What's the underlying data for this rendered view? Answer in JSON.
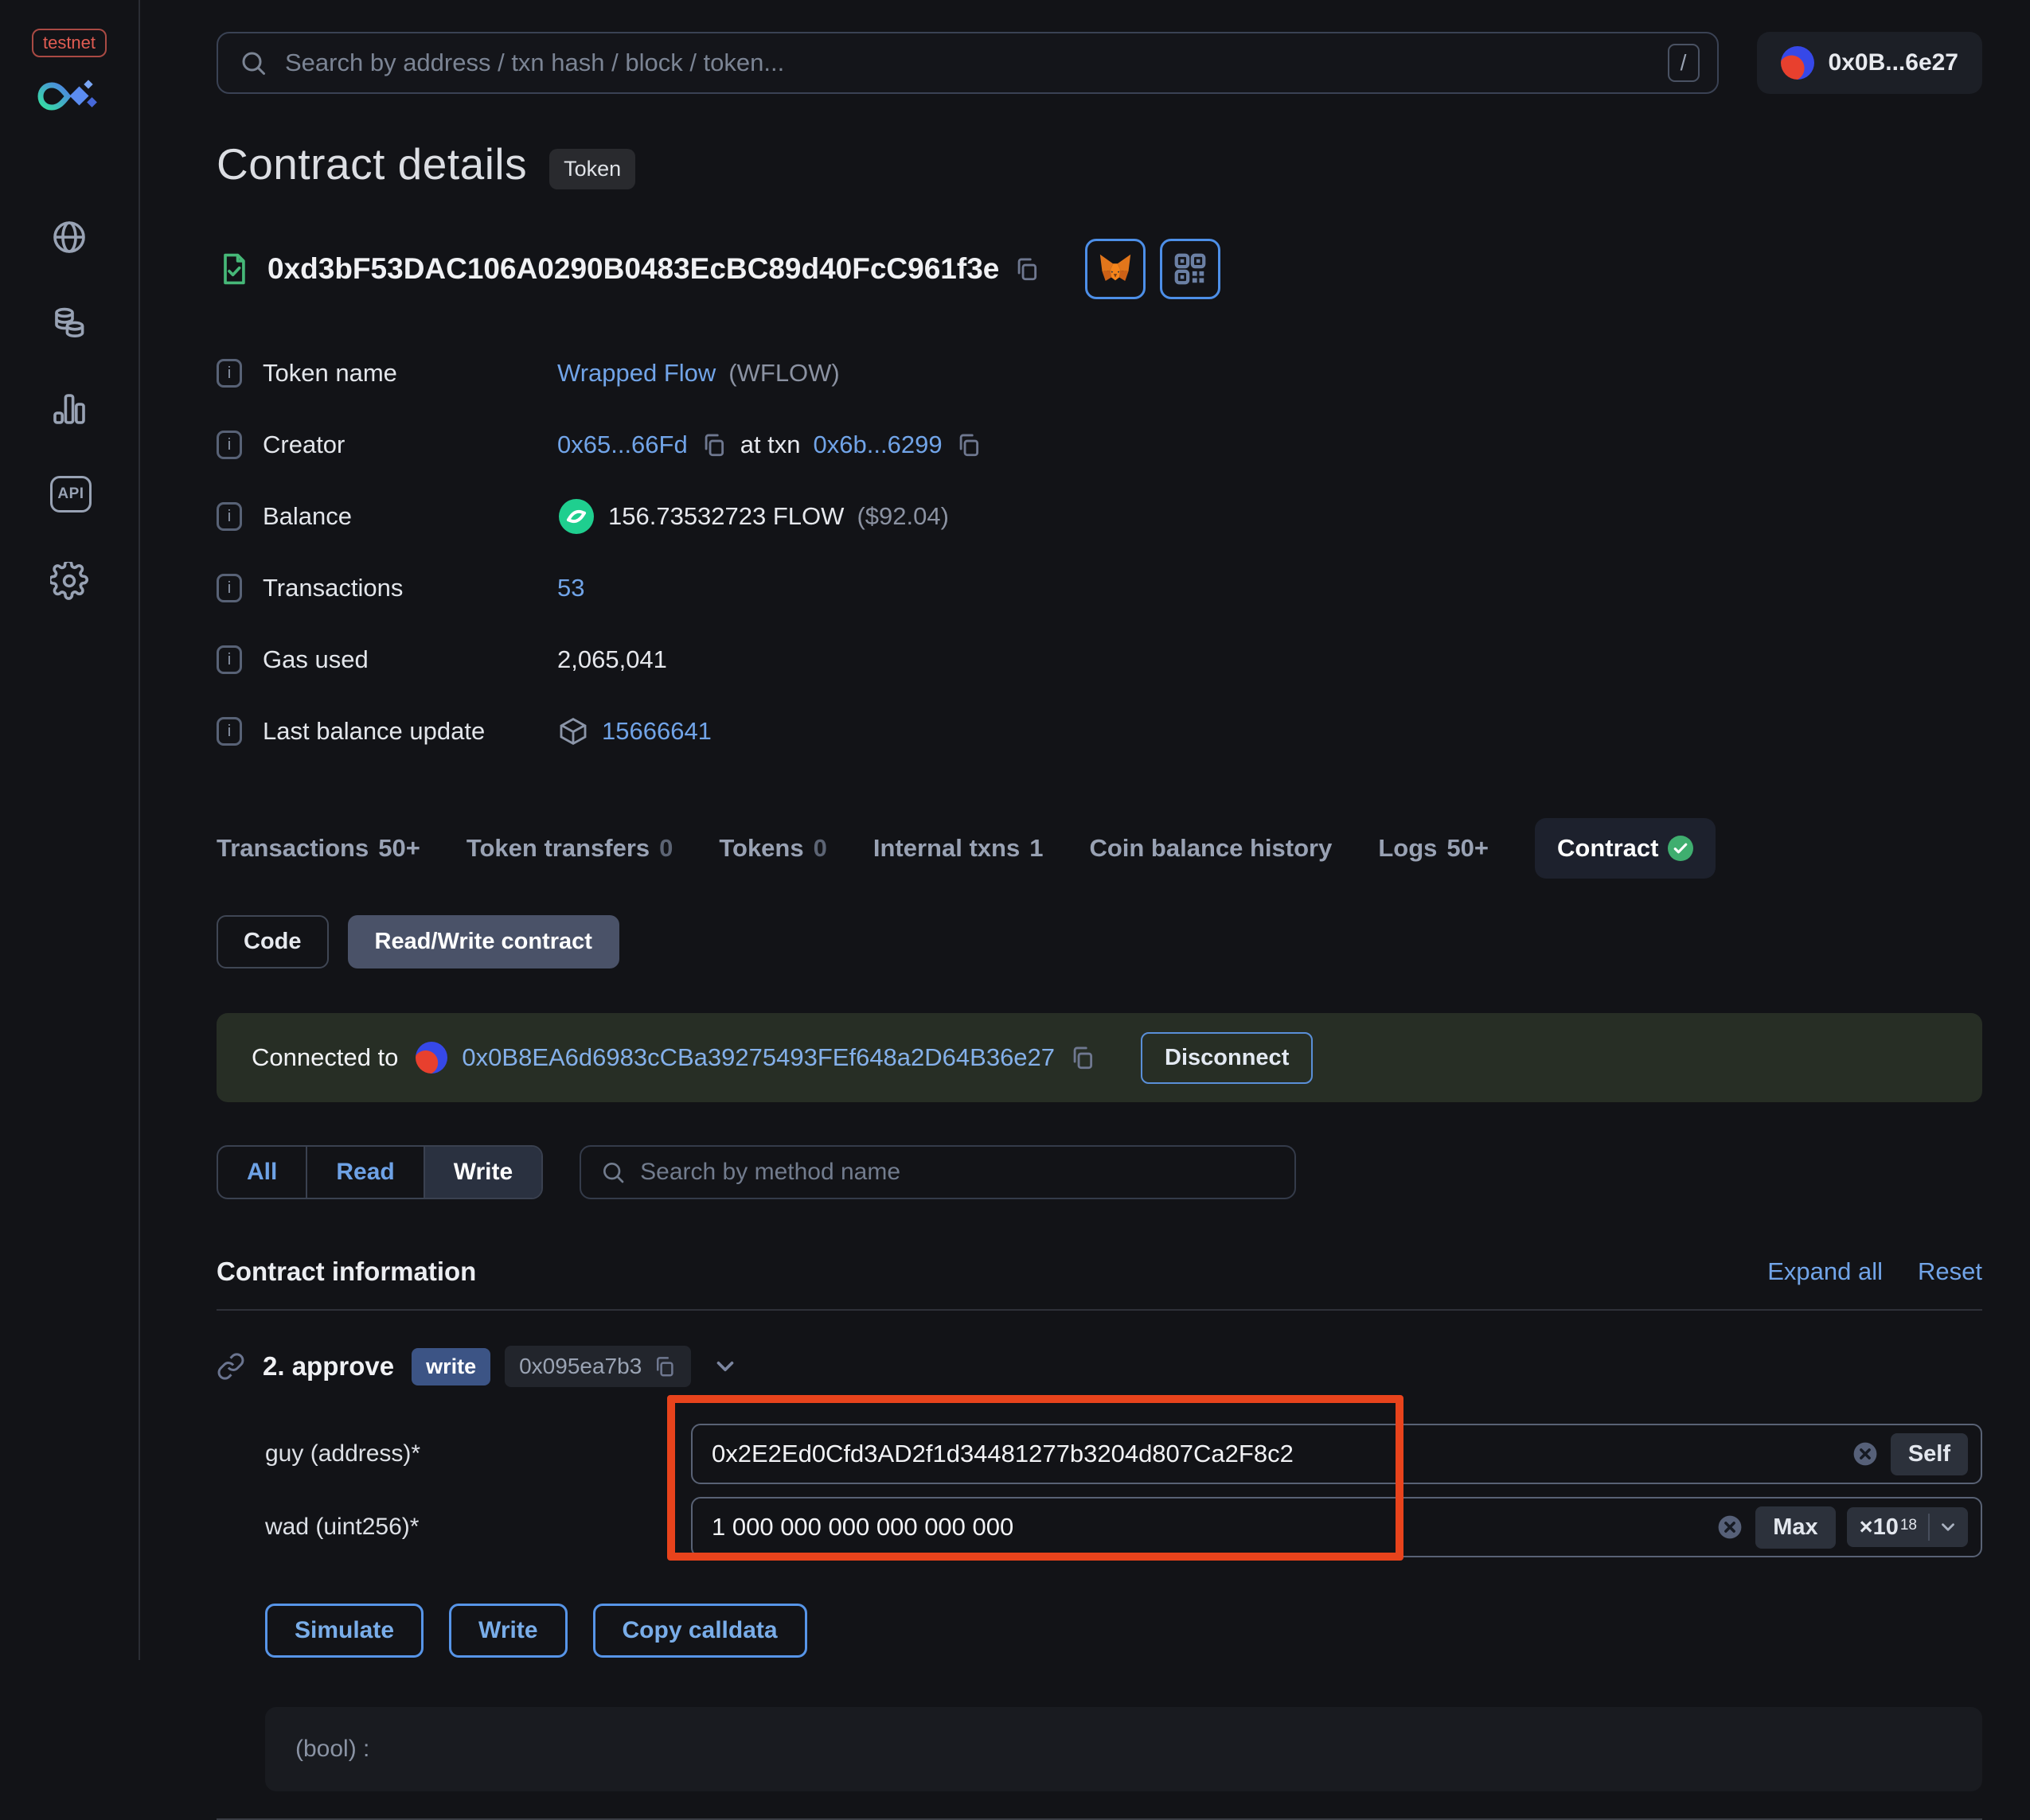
{
  "colors": {
    "accent_blue": "#71a4e8",
    "flow_green": "#1fcf8f",
    "annotation_red": "#e8431c",
    "write_badge_blue": "#3c5485",
    "connected_banner_green": "#272e25"
  },
  "sidebar": {
    "network_badge": "testnet",
    "icons": [
      "logo",
      "globe-icon",
      "coins-icon",
      "bar-chart-icon",
      "api-icon",
      "gear-icon"
    ]
  },
  "topbar": {
    "search_placeholder": "Search by address / txn hash / block / token...",
    "shortcut_key": "/",
    "account_label": "0x0B...6e27"
  },
  "header": {
    "title": "Contract details",
    "type_badge": "Token",
    "address": "0xd3bF53DAC106A0290B0483EcBC89d40FcC961f3e"
  },
  "info": {
    "token_name": {
      "label": "Token name",
      "link": "Wrapped Flow",
      "suffix": "(WFLOW)"
    },
    "creator": {
      "label": "Creator",
      "address": "0x65...66Fd",
      "middle": "at txn",
      "txn": "0x6b...6299"
    },
    "balance": {
      "label": "Balance",
      "amount": "156.73532723 FLOW",
      "usd": "($92.04)"
    },
    "transactions": {
      "label": "Transactions",
      "value": "53"
    },
    "gas_used": {
      "label": "Gas used",
      "value": "2,065,041"
    },
    "last_balance_update": {
      "label": "Last balance update",
      "block": "15666641"
    }
  },
  "tabs": [
    {
      "label": "Transactions",
      "count": "50+"
    },
    {
      "label": "Token transfers",
      "count": "0"
    },
    {
      "label": "Tokens",
      "count": "0"
    },
    {
      "label": "Internal txns",
      "count": "1"
    },
    {
      "label": "Coin balance history",
      "count": ""
    },
    {
      "label": "Logs",
      "count": "50+"
    },
    {
      "label": "Contract",
      "count": ""
    }
  ],
  "contract_subtabs": {
    "code": "Code",
    "read_write": "Read/Write contract"
  },
  "connection": {
    "prefix": "Connected to",
    "address": "0x0B8EA6d6983cCBa39275493FEf648a2D64B36e27",
    "disconnect_label": "Disconnect"
  },
  "methods_filter": {
    "options": [
      "All",
      "Read",
      "Write"
    ],
    "selected": "Write",
    "search_placeholder": "Search by method name"
  },
  "section": {
    "title": "Contract information",
    "expand_all": "Expand all",
    "reset": "Reset"
  },
  "method": {
    "name": "2. approve",
    "badge": "write",
    "selector": "0x095ea7b3",
    "params": [
      {
        "label": "guy (address)*",
        "value": "0x2E2Ed0Cfd3AD2f1d34481277b3204d807Ca2F8c2",
        "action": "Self"
      },
      {
        "label": "wad (uint256)*",
        "value": "1 000 000 000 000 000 000",
        "action": "Max",
        "multiplier": "×10",
        "exponent": "18"
      }
    ],
    "actions": [
      "Simulate",
      "Write",
      "Copy calldata"
    ],
    "output": "(bool) :"
  }
}
